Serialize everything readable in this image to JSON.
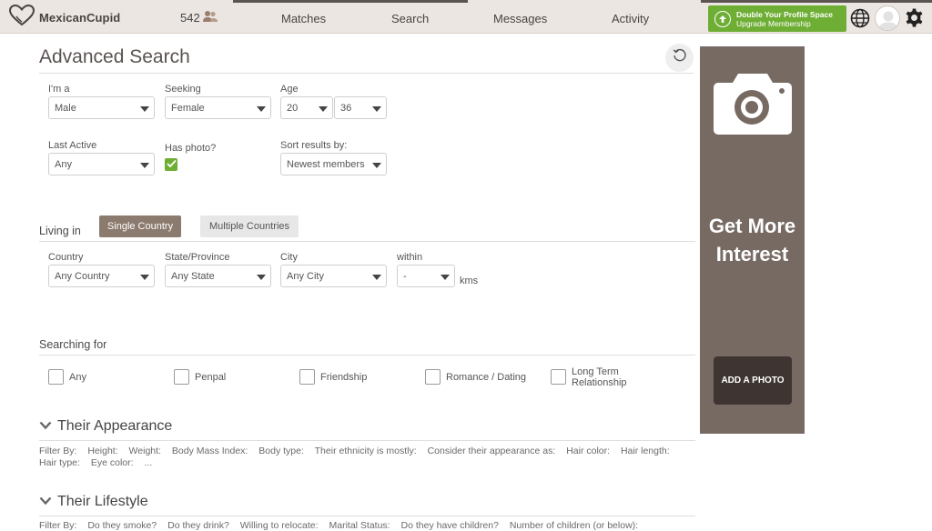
{
  "app": {
    "logo_text": "MexicanCupid",
    "count": "542",
    "nav": [
      "Matches",
      "Search",
      "Messages",
      "Activity"
    ],
    "upgrade_line1": "Double Your Profile Space",
    "upgrade_line2": "Upgrade Membership",
    "accent_color": "#6fae35",
    "brand_color": "#8b7a6e",
    "icons": [
      "heart-logo-icon",
      "people-icon",
      "upload-arrow-icon",
      "globe-icon",
      "avatar",
      "gear-icon",
      "reset-icon",
      "chevron-down-icon",
      "camera-icon",
      "checkmark-icon"
    ]
  },
  "page": {
    "title": "Advanced Search",
    "im_a": {
      "label": "I'm a",
      "value": "Male"
    },
    "seeking": {
      "label": "Seeking",
      "value": "Female"
    },
    "age": {
      "label": "Age",
      "min": "20",
      "max": "36"
    },
    "last_active": {
      "label": "Last Active",
      "value": "Any"
    },
    "has_photo": {
      "label": "Has photo?",
      "checked": true
    },
    "sort": {
      "label": "Sort results by:",
      "value": "Newest members"
    },
    "living_in": {
      "label": "Living in",
      "tabs": [
        "Single Country",
        "Multiple Countries"
      ],
      "active_tab": "Single Country"
    },
    "country": {
      "label": "Country",
      "value": "Any Country"
    },
    "state": {
      "label": "State/Province",
      "value": "Any State"
    },
    "city": {
      "label": "City",
      "value": "Any City"
    },
    "within": {
      "label": "within",
      "value": "-",
      "unit": "kms"
    },
    "searching_for": {
      "label": "Searching for",
      "options": [
        "Any",
        "Penpal",
        "Friendship",
        "Romance / Dating",
        "Long Term",
        "Relationship"
      ]
    },
    "appearance": {
      "title": "Their Appearance",
      "filters": [
        "Filter By:",
        "Height:",
        "Weight:",
        "Body Mass Index:",
        "Body type:",
        "Their ethnicity is mostly:",
        "Consider their appearance as:",
        "Hair color:",
        "Hair length:"
      ],
      "filters2": [
        "Hair type:",
        "Eye color:",
        "..."
      ]
    },
    "lifestyle": {
      "title": "Their Lifestyle",
      "filters": [
        "Filter By:",
        "Do they smoke?",
        "Do they drink?",
        "Willing to relocate:",
        "Marital Status:",
        "Do they have children?",
        "Number of children (or below):"
      ]
    }
  },
  "ad": {
    "headline1": "Get More",
    "headline2": "Interest",
    "button": "ADD A PHOTO"
  }
}
